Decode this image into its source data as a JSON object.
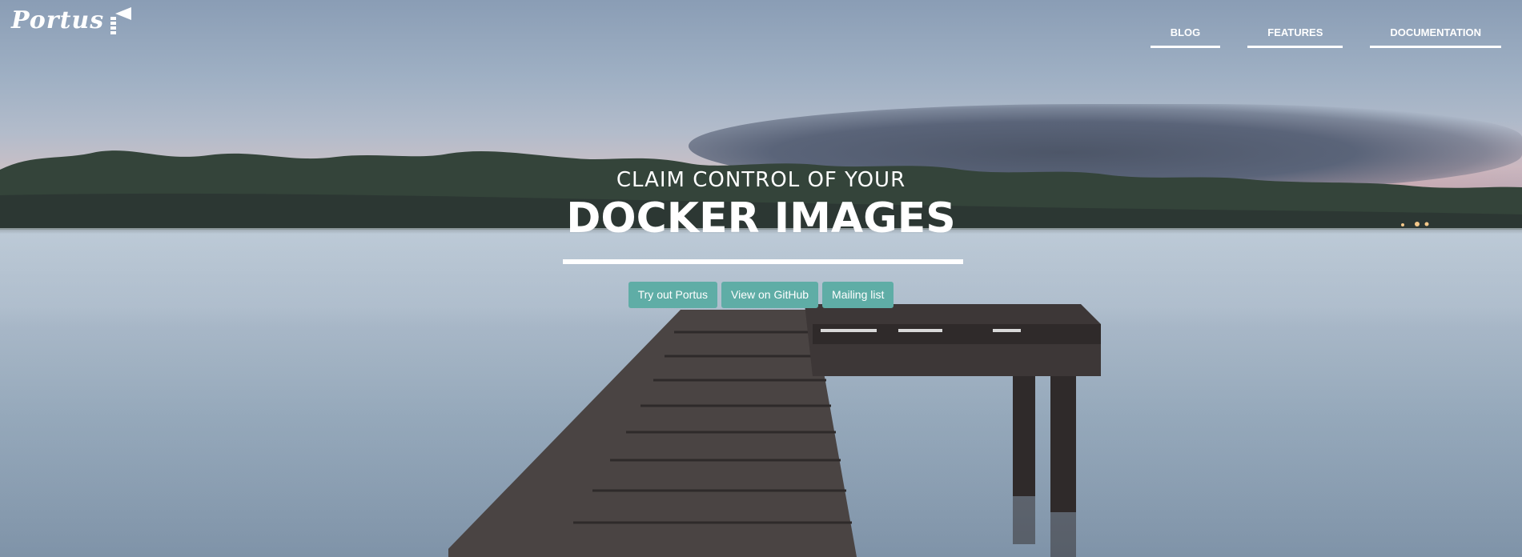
{
  "brand": {
    "name": "Portus"
  },
  "nav": {
    "items": [
      {
        "label": "BLOG"
      },
      {
        "label": "FEATURES"
      },
      {
        "label": "DOCUMENTATION"
      }
    ]
  },
  "hero": {
    "subtitle": "CLAIM CONTROL OF YOUR",
    "title": "DOCKER IMAGES",
    "buttons": [
      {
        "label": "Try out Portus"
      },
      {
        "label": "View on GitHub"
      },
      {
        "label": "Mailing list"
      }
    ]
  },
  "colors": {
    "accent": "#5fada6",
    "text": "#ffffff"
  },
  "icons": {
    "logo": "lighthouse-icon"
  }
}
